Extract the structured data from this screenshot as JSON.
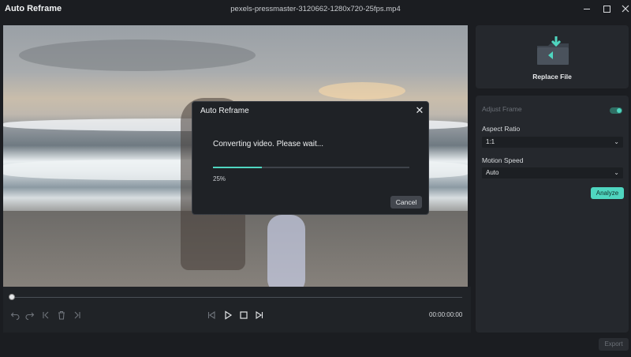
{
  "window": {
    "app_title": "Auto Reframe",
    "file_name": "pexels-pressmaster-3120662-1280x720-25fps.mp4",
    "controls": {
      "minimize": "minimize-icon",
      "maximize": "maximize-icon",
      "close": "close-icon"
    }
  },
  "modal": {
    "title": "Auto Reframe",
    "message": "Converting video. Please wait...",
    "progress": 0.25,
    "progress_label": "25%",
    "cancel_label": "Cancel"
  },
  "player": {
    "position": 0.0,
    "timecode": "00:00:00:00",
    "icons": [
      "undo-icon",
      "redo-icon",
      "prev-mark-icon",
      "delete-icon",
      "next-mark-icon",
      "frame-back-icon",
      "play-icon",
      "stop-icon",
      "frame-forward-icon"
    ]
  },
  "sidebar": {
    "replace_file_label": "Replace File",
    "adjust_frame_label": "Adjust Frame",
    "adjust_frame_enabled": true,
    "aspect_ratio": {
      "label": "Aspect Ratio",
      "value": "1:1"
    },
    "motion_speed": {
      "label": "Motion Speed",
      "value": "Auto"
    },
    "analyze_label": "Analyze"
  },
  "footer": {
    "export_label": "Export"
  },
  "colors": {
    "accent": "#4fd6c0",
    "background": "#1b1d21",
    "panel": "#25282d"
  }
}
